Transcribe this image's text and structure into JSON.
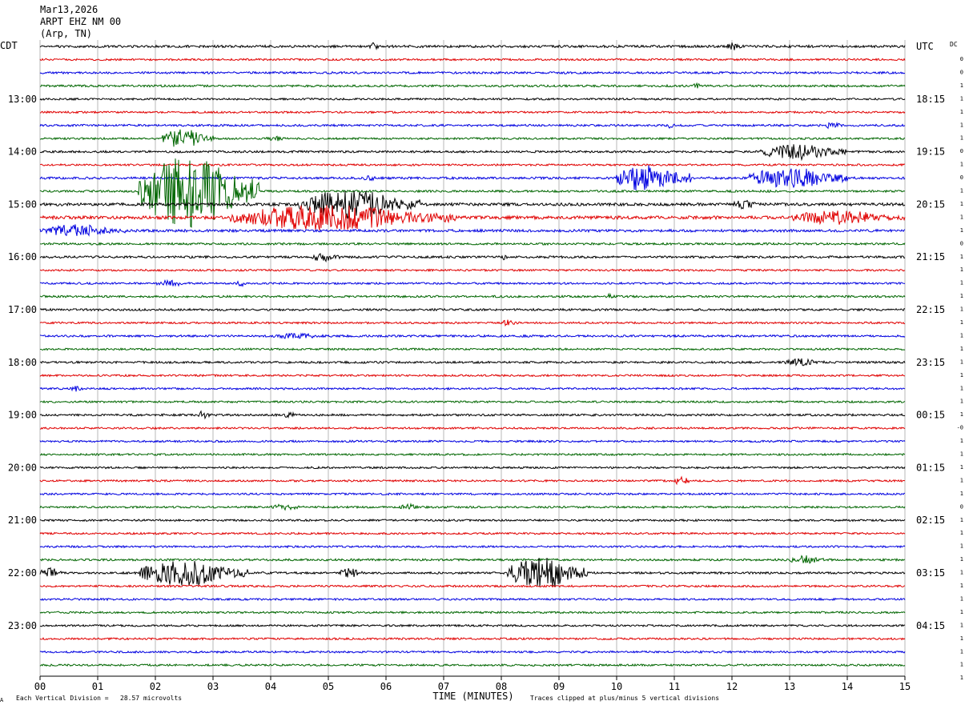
{
  "header": {
    "date": "Mar13,2026",
    "station": "ARPT EHZ NM 00",
    "location": "(Arp, TN)"
  },
  "axes": {
    "left_tz": "CDT",
    "right_tz": "UTC",
    "dc_label": "DC",
    "xlabel": "TIME (MINUTES)",
    "x_ticks": [
      "00",
      "01",
      "02",
      "03",
      "04",
      "05",
      "06",
      "07",
      "08",
      "09",
      "10",
      "11",
      "12",
      "13",
      "14",
      "15"
    ]
  },
  "footer": {
    "scale_note": "Each Vertical Division =   28.57 microvolts",
    "clip_note": "Traces clipped at plus/minus 5 vertical divisions",
    "corner_mark": "A"
  },
  "colors": {
    "black": "#000000",
    "red": "#e00000",
    "blue": "#0000e0",
    "green": "#006600",
    "grid": "#888888"
  },
  "chart_data": {
    "type": "line",
    "title": "",
    "x_unit": "minutes",
    "xlim": [
      0,
      15
    ],
    "trace_minutes": 15,
    "trace_count": 48,
    "color_cycle": [
      "black",
      "red",
      "blue",
      "green"
    ],
    "left_hour_labels": [
      {
        "trace": 4,
        "label": "13:00"
      },
      {
        "trace": 8,
        "label": "14:00"
      },
      {
        "trace": 12,
        "label": "15:00"
      },
      {
        "trace": 16,
        "label": "16:00"
      },
      {
        "trace": 20,
        "label": "17:00"
      },
      {
        "trace": 24,
        "label": "18:00"
      },
      {
        "trace": 28,
        "label": "19:00"
      },
      {
        "trace": 32,
        "label": "20:00"
      },
      {
        "trace": 36,
        "label": "21:00"
      },
      {
        "trace": 40,
        "label": "22:00"
      },
      {
        "trace": 44,
        "label": "23:00"
      }
    ],
    "right_hour_labels": [
      {
        "trace": 0,
        "label": "UTC"
      },
      {
        "trace": 4,
        "label": "18:15"
      },
      {
        "trace": 8,
        "label": "19:15"
      },
      {
        "trace": 12,
        "label": "20:15"
      },
      {
        "trace": 16,
        "label": "21:15"
      },
      {
        "trace": 20,
        "label": "22:15"
      },
      {
        "trace": 24,
        "label": "23:15"
      },
      {
        "trace": 28,
        "label": "00:15"
      },
      {
        "trace": 32,
        "label": "01:15"
      },
      {
        "trace": 36,
        "label": "02:15"
      },
      {
        "trace": 40,
        "label": "03:15"
      },
      {
        "trace": 44,
        "label": "04:15"
      }
    ],
    "dc_offsets": [
      "0",
      "0",
      "1",
      "1",
      "1",
      "1",
      "1",
      "0",
      "1",
      "0",
      "1",
      "1",
      "1",
      "1",
      "0",
      "1",
      "1",
      "1",
      "1",
      "1",
      "1",
      "1",
      "1",
      "1",
      "1",
      "1",
      "1",
      "1",
      "-0",
      "1",
      "1",
      "1",
      "1",
      "1",
      "0",
      "1",
      "1",
      "1",
      "1",
      "1",
      "1",
      "1",
      "1",
      "1",
      "1",
      "1",
      "1",
      "1"
    ],
    "base_noise": [
      1.5,
      1.2,
      1.3,
      1.3,
      1.2,
      1.2,
      1.3,
      1.2,
      1.3,
      1.2,
      1.4,
      1.3,
      1.8,
      2.0,
      1.6,
      1.3,
      1.4,
      1.2,
      1.2,
      1.3,
      1.3,
      1.2,
      1.3,
      1.2,
      1.3,
      1.2,
      1.2,
      1.2,
      1.3,
      1.2,
      1.2,
      1.2,
      1.2,
      1.2,
      1.2,
      1.2,
      1.2,
      1.2,
      1.2,
      1.3,
      1.3,
      1.2,
      1.2,
      1.2,
      1.2,
      1.2,
      1.2,
      1.2
    ],
    "events": [
      {
        "trace": 0,
        "start_min": 5.7,
        "end_min": 5.9,
        "amp": 6
      },
      {
        "trace": 0,
        "start_min": 11.9,
        "end_min": 12.2,
        "amp": 5
      },
      {
        "trace": 3,
        "start_min": 11.3,
        "end_min": 11.5,
        "amp": 4
      },
      {
        "trace": 6,
        "start_min": 10.9,
        "end_min": 11.0,
        "amp": 5
      },
      {
        "trace": 6,
        "start_min": 13.5,
        "end_min": 14.0,
        "amp": 4
      },
      {
        "trace": 7,
        "start_min": 2.1,
        "end_min": 3.0,
        "amp": 12
      },
      {
        "trace": 7,
        "start_min": 3.9,
        "end_min": 4.3,
        "amp": 4
      },
      {
        "trace": 8,
        "start_min": 12.5,
        "end_min": 14.0,
        "amp": 10
      },
      {
        "trace": 10,
        "start_min": 5.6,
        "end_min": 5.9,
        "amp": 4
      },
      {
        "trace": 10,
        "start_min": 10.0,
        "end_min": 11.3,
        "amp": 18
      },
      {
        "trace": 10,
        "start_min": 12.3,
        "end_min": 14.0,
        "amp": 14
      },
      {
        "trace": 11,
        "start_min": 1.7,
        "end_min": 3.8,
        "amp": 45
      },
      {
        "trace": 12,
        "start_min": 4.5,
        "end_min": 6.6,
        "amp": 18
      },
      {
        "trace": 12,
        "start_min": 12.0,
        "end_min": 12.5,
        "amp": 6
      },
      {
        "trace": 13,
        "start_min": 3.3,
        "end_min": 7.2,
        "amp": 16
      },
      {
        "trace": 13,
        "start_min": 13.0,
        "end_min": 15.0,
        "amp": 9
      },
      {
        "trace": 14,
        "start_min": 0.0,
        "end_min": 1.5,
        "amp": 8
      },
      {
        "trace": 16,
        "start_min": 4.7,
        "end_min": 5.2,
        "amp": 6
      },
      {
        "trace": 16,
        "start_min": 8.0,
        "end_min": 8.1,
        "amp": 5
      },
      {
        "trace": 18,
        "start_min": 2.0,
        "end_min": 2.6,
        "amp": 4
      },
      {
        "trace": 18,
        "start_min": 3.4,
        "end_min": 3.6,
        "amp": 4
      },
      {
        "trace": 19,
        "start_min": 9.8,
        "end_min": 10.0,
        "amp": 4
      },
      {
        "trace": 21,
        "start_min": 8.0,
        "end_min": 8.3,
        "amp": 4
      },
      {
        "trace": 22,
        "start_min": 4.0,
        "end_min": 5.0,
        "amp": 4
      },
      {
        "trace": 24,
        "start_min": 12.9,
        "end_min": 13.6,
        "amp": 5
      },
      {
        "trace": 26,
        "start_min": 0.5,
        "end_min": 0.8,
        "amp": 4
      },
      {
        "trace": 28,
        "start_min": 2.7,
        "end_min": 3.0,
        "amp": 5
      },
      {
        "trace": 28,
        "start_min": 4.2,
        "end_min": 4.5,
        "amp": 4
      },
      {
        "trace": 33,
        "start_min": 11.0,
        "end_min": 11.3,
        "amp": 6
      },
      {
        "trace": 35,
        "start_min": 4.0,
        "end_min": 4.6,
        "amp": 4
      },
      {
        "trace": 35,
        "start_min": 6.2,
        "end_min": 6.7,
        "amp": 4
      },
      {
        "trace": 39,
        "start_min": 13.0,
        "end_min": 13.6,
        "amp": 6
      },
      {
        "trace": 40,
        "start_min": 0.0,
        "end_min": 0.4,
        "amp": 7
      },
      {
        "trace": 40,
        "start_min": 1.7,
        "end_min": 3.6,
        "amp": 16
      },
      {
        "trace": 40,
        "start_min": 5.2,
        "end_min": 5.6,
        "amp": 7
      },
      {
        "trace": 40,
        "start_min": 8.1,
        "end_min": 9.5,
        "amp": 20
      }
    ]
  }
}
